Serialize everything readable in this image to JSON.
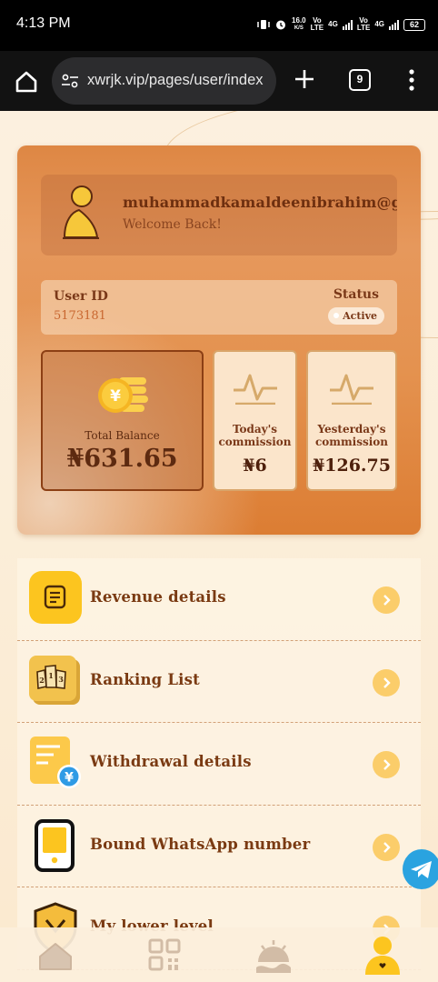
{
  "status_bar": {
    "time": "4:13 PM",
    "speed_value": "16.0",
    "speed_unit": "K/S",
    "sim1_volte": "Vo",
    "sim1_lte": "LTE",
    "sim1_net": "4G",
    "sim2_volte": "Vo",
    "sim2_lte": "LTE",
    "sim2_net": "4G",
    "battery": "62"
  },
  "browser": {
    "url": "xwrjk.vip/pages/user/index",
    "tab_count": "9"
  },
  "profile": {
    "username": "muhammadkamaldeenibrahim@gmail.com",
    "welcome": "Welcome Back!",
    "user_id_label": "User ID",
    "user_id": "5173181",
    "status_label": "Status",
    "status_value": "Active"
  },
  "stats": {
    "total_balance_label": "Total Balance",
    "total_balance": "₦631.65",
    "today_commission_label_1": "Today's",
    "today_commission_label_2": "commission",
    "today_commission": "₦6",
    "yesterday_commission_label_1": "Yesterday's",
    "yesterday_commission_label_2": "commission",
    "yesterday_commission": "₦126.75"
  },
  "menu": [
    {
      "label": "Revenue details",
      "icon": "document-list-icon"
    },
    {
      "label": "Ranking List",
      "icon": "podium-icon"
    },
    {
      "label": "Withdrawal details",
      "icon": "yuan-receipt-icon"
    },
    {
      "label": "Bound WhatsApp number",
      "icon": "phone-icon"
    },
    {
      "label": "My lower level",
      "icon": "shield-icon"
    }
  ],
  "bottom_nav": [
    {
      "icon": "home-icon"
    },
    {
      "icon": "qr-code-icon"
    },
    {
      "icon": "sunrise-icon"
    },
    {
      "icon": "user-icon"
    }
  ],
  "colors": {
    "card_orange": "#dc7d33",
    "text_brown": "#7a3a12",
    "accent_yellow": "#fbcd6a",
    "telegram_blue": "#2aa3e0"
  }
}
